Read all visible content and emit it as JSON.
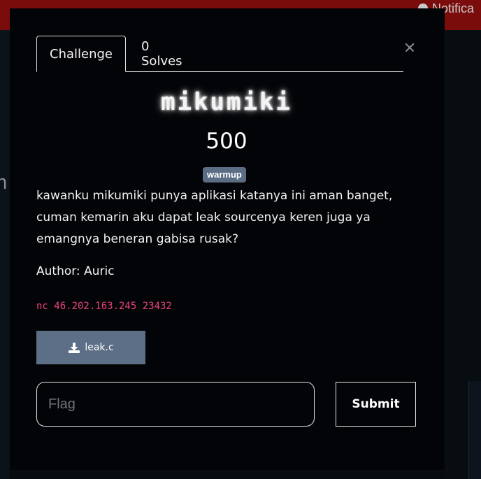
{
  "background": {
    "notification_label": "Notifica",
    "left_glyph": "n"
  },
  "modal": {
    "tabs": [
      {
        "label": "Challenge",
        "active": true
      },
      {
        "label": "0 Solves",
        "active": false
      }
    ],
    "title": "mikumiki",
    "points": "500",
    "tag": "warmup",
    "description": "kawanku mikumiki punya aplikasi katanya ini aman banget, cuman kemarin aku dapat leak sourcenya keren juga ya emangnya beneran gabisa rusak?",
    "author": "Author: Auric",
    "connection": "nc 46.202.163.245 23432",
    "file_button": "leak.c",
    "flag_placeholder": "Flag",
    "submit_label": "Submit"
  },
  "colors": {
    "accent_button": "#5d6f86",
    "tag_bg": "#5b6d84",
    "code_pink": "#e8437c",
    "topbar_red": "#7a0c0c"
  },
  "icons": {
    "close": "close-icon",
    "download": "download-icon",
    "bell": "bell-icon"
  }
}
